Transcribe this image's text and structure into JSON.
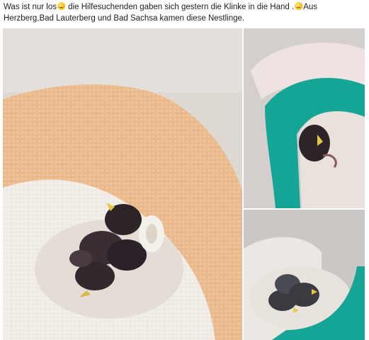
{
  "post": {
    "caption_part1": "Was ist nur los",
    "caption_part2": " die Hilfesuchenden gaben sich gestern die Klinke in die Hand .",
    "caption_part3": "Aus Herzberg,Bad Lauterberg und Bad Sachsa kamen diese Nestlinge.",
    "emoji_icon": "sad-face-emoji"
  },
  "colors": {
    "towel_orange": "#e9b98c",
    "towel_white": "#efeae4",
    "crochet_teal": "#14a597",
    "bird_dark": "#2c2428",
    "beak_yellow": "#e6c646"
  }
}
